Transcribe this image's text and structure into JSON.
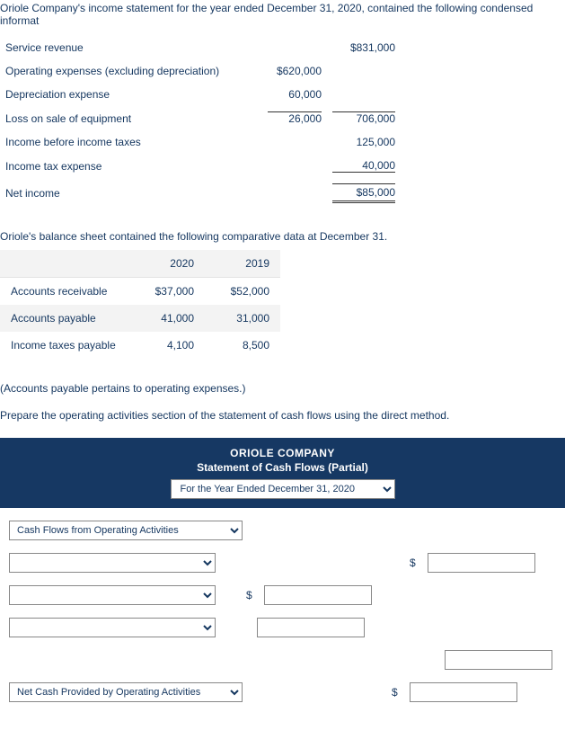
{
  "intro": "Oriole Company's income statement for the year ended December 31, 2020, contained the following condensed informat",
  "income_statement": {
    "service_revenue": {
      "label": "Service revenue",
      "col1": "",
      "col2": "$831,000"
    },
    "operating_expenses": {
      "label": "Operating expenses (excluding depreciation)",
      "col1": "$620,000",
      "col2": ""
    },
    "depreciation": {
      "label": "Depreciation expense",
      "col1": "60,000",
      "col2": ""
    },
    "loss_on_sale": {
      "label": "Loss on sale of equipment",
      "col1": "26,000",
      "col2": "706,000"
    },
    "income_before_tax": {
      "label": "Income before income taxes",
      "col1": "",
      "col2": "125,000"
    },
    "income_tax_expense": {
      "label": "Income tax expense",
      "col1": "",
      "col2": "40,000"
    },
    "net_income": {
      "label": "Net income",
      "col1": "",
      "col2": "$85,000"
    }
  },
  "balance_intro": "Oriole's balance sheet contained the following comparative data at December 31.",
  "balance": {
    "headers": {
      "y2020": "2020",
      "y2019": "2019"
    },
    "rows": [
      {
        "label": "Accounts receivable",
        "y2020": "$37,000",
        "y2019": "$52,000"
      },
      {
        "label": "Accounts payable",
        "y2020": "41,000",
        "y2019": "31,000"
      },
      {
        "label": "Income taxes payable",
        "y2020": "4,100",
        "y2019": "8,500"
      }
    ]
  },
  "note": "(Accounts payable pertains to operating expenses.)",
  "instruction": "Prepare the operating activities section of the statement of cash flows using the direct method.",
  "cf": {
    "company": "ORIOLE COMPANY",
    "title": "Statement of Cash Flows (Partial)",
    "period_option": "For the Year Ended December 31, 2020",
    "section_label_option": "Cash Flows from Operating Activities",
    "net_cash_label_option": "Net Cash Provided by Operating Activities",
    "dollar": "$"
  }
}
